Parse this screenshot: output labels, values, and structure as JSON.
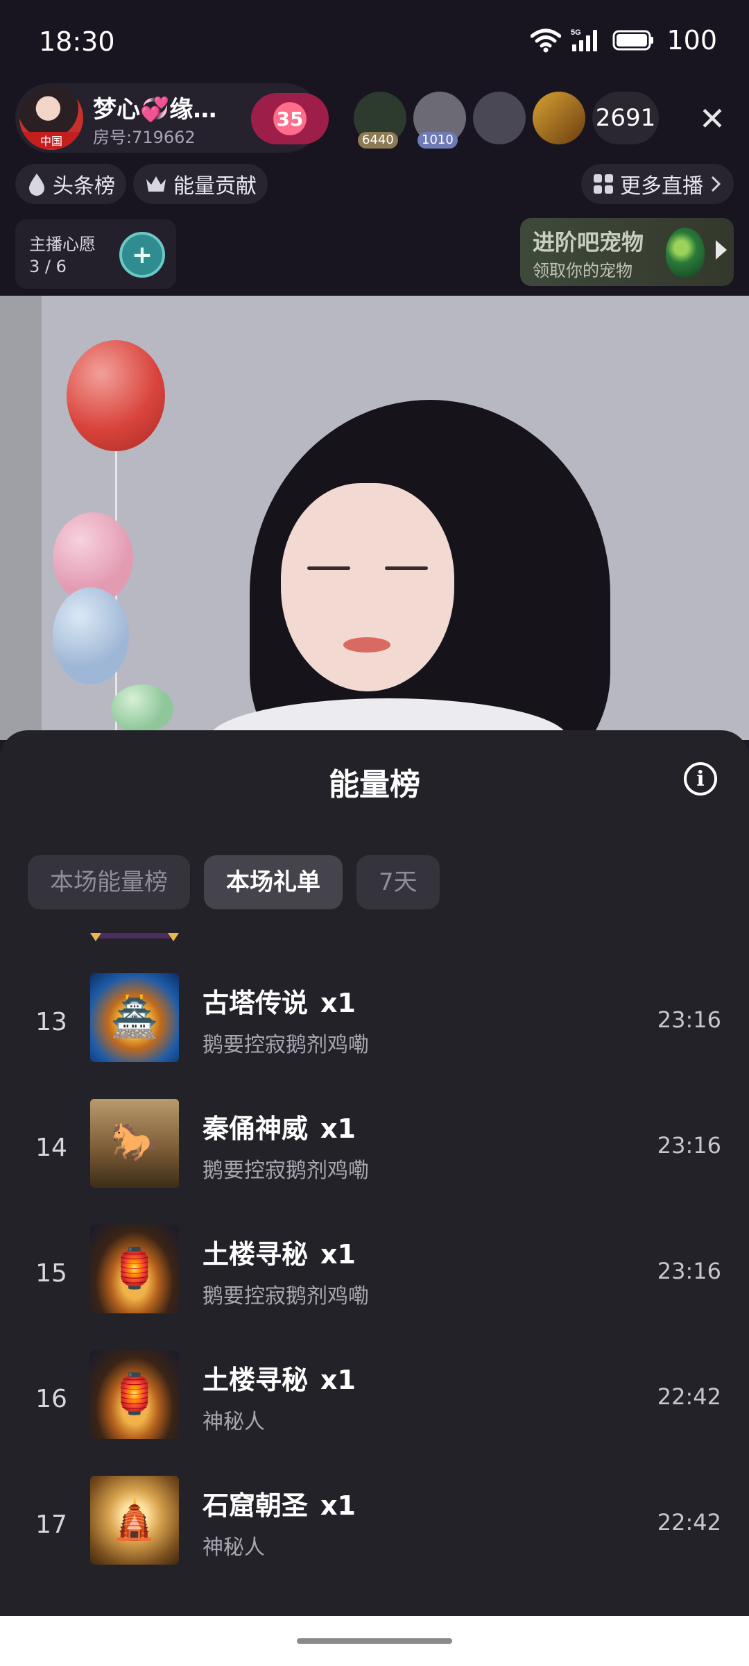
{
  "status": {
    "time": "18:30",
    "network": "5G",
    "battery": "100"
  },
  "anchor": {
    "name": "梦心💞缘…",
    "room": "房号:719662",
    "fan_level": "35"
  },
  "viewers": {
    "items": [
      {
        "level": "6440",
        "color": "#2d3a2e",
        "badge": "#8b7a52"
      },
      {
        "level": "1010",
        "color": "#6c6a74",
        "badge": "#6e7bb6"
      },
      {
        "level": "",
        "color": "#4a4855",
        "badge": ""
      },
      {
        "level": "",
        "color": "#8a6a22",
        "badge": ""
      }
    ],
    "count": "2691"
  },
  "chips": {
    "headline": "头条榜",
    "energy": "能量贡献",
    "more_live": "更多直播"
  },
  "wish": {
    "title": "主播心愿",
    "progress": "3 / 6"
  },
  "pet_banner": {
    "title": "进阶吧宠物",
    "subtitle": "领取你的宠物"
  },
  "sheet": {
    "title": "能量榜",
    "tabs": [
      {
        "label": "本场能量榜",
        "active": false
      },
      {
        "label": "本场礼单",
        "active": true
      },
      {
        "label": "7天",
        "active": false
      }
    ],
    "rows": [
      {
        "rank": "13",
        "gift": "古塔传说",
        "qty": "x1",
        "sender": "鹅要控寂鹅剂鸡嘞",
        "time": "23:16",
        "thumb": "tower"
      },
      {
        "rank": "14",
        "gift": "秦俑神威",
        "qty": "x1",
        "sender": "鹅要控寂鹅剂鸡嘞",
        "time": "23:16",
        "thumb": "soldier"
      },
      {
        "rank": "15",
        "gift": "土楼寻秘",
        "qty": "x1",
        "sender": "鹅要控寂鹅剂鸡嘞",
        "time": "23:16",
        "thumb": "tulou"
      },
      {
        "rank": "16",
        "gift": "土楼寻秘",
        "qty": "x1",
        "sender": "神秘人",
        "time": "22:42",
        "thumb": "tulou"
      },
      {
        "rank": "17",
        "gift": "石窟朝圣",
        "qty": "x1",
        "sender": "神秘人",
        "time": "22:42",
        "thumb": "buddha"
      }
    ]
  },
  "icons": {
    "wifi": "wifi-icon",
    "signal": "signal-icon",
    "battery": "battery-icon",
    "close": "close-icon",
    "drop": "drop-icon",
    "crown": "crown-icon",
    "grid": "grid-icon",
    "chevron": "chevron-right-icon",
    "info": "info-icon",
    "plus": "plus-icon"
  },
  "colors": {
    "sheet_bg": "#232229",
    "header_bg": "#181520",
    "tab_active_bg": "#45444d",
    "tab_bg": "#35343c"
  }
}
